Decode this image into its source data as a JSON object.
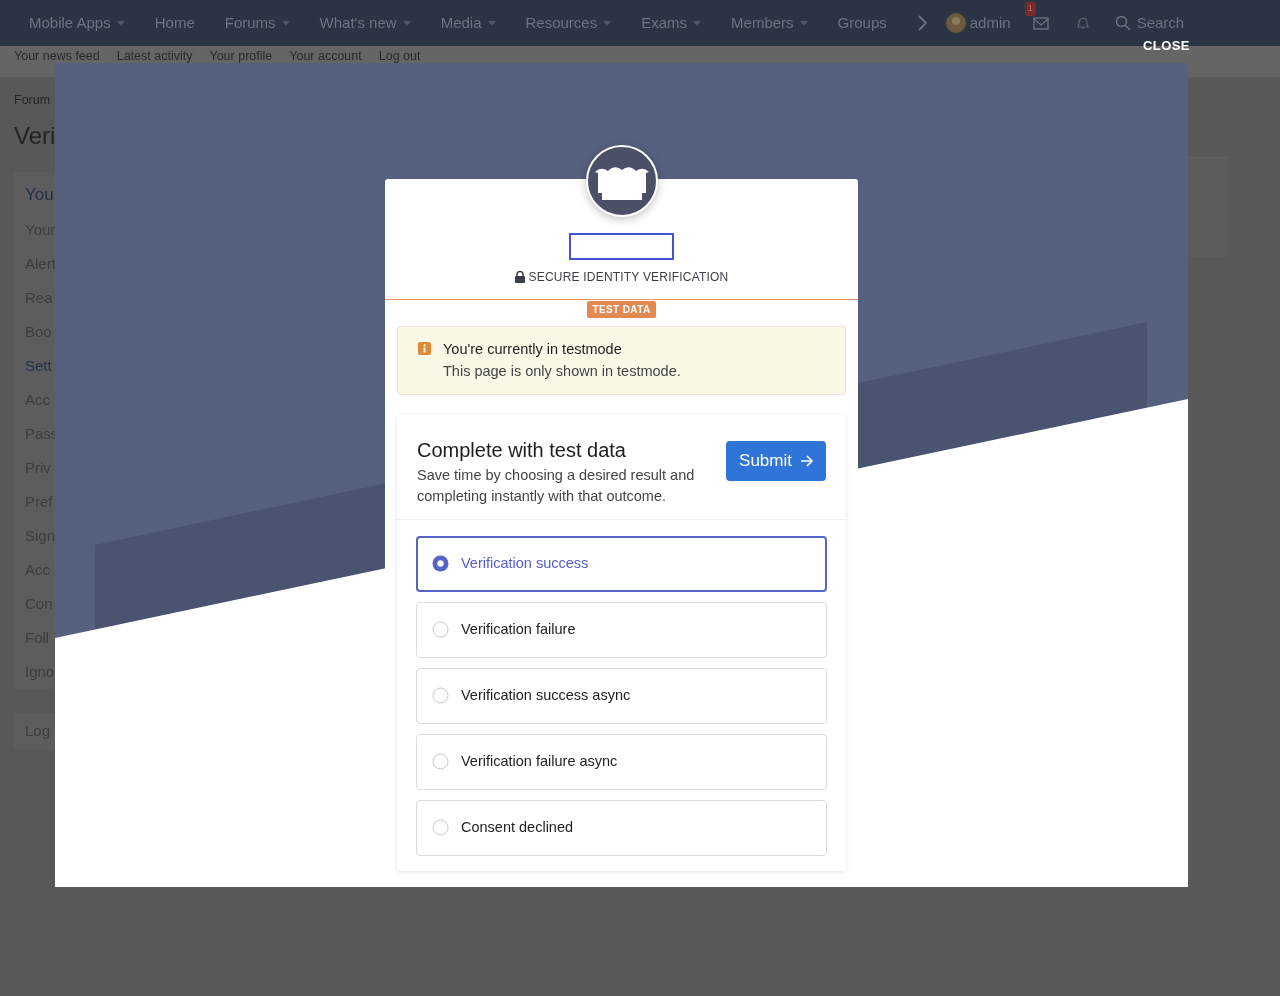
{
  "nav": {
    "items": [
      {
        "label": "Mobile Apps",
        "dropdown": true
      },
      {
        "label": "Home",
        "dropdown": false
      },
      {
        "label": "Forums",
        "dropdown": true
      },
      {
        "label": "What's new",
        "dropdown": true
      },
      {
        "label": "Media",
        "dropdown": true
      },
      {
        "label": "Resources",
        "dropdown": true
      },
      {
        "label": "Exams",
        "dropdown": true
      },
      {
        "label": "Members",
        "dropdown": true
      },
      {
        "label": "Groups",
        "dropdown": false
      }
    ],
    "user": "admin",
    "inbox_count": "1",
    "search": "Search"
  },
  "subnav": [
    "Your news feed",
    "Latest activity",
    "Your profile",
    "Your account",
    "Log out"
  ],
  "breadcrumb": "Forum",
  "page_title": "Veri",
  "sidebar": {
    "heading": "You",
    "items": [
      {
        "label": "Your",
        "kind": "link"
      },
      {
        "label": "Alert",
        "kind": "link"
      },
      {
        "label": "Rea",
        "kind": "link"
      },
      {
        "label": "Boo",
        "kind": "link"
      },
      {
        "label": "Sett",
        "kind": "heading"
      },
      {
        "label": "Acc",
        "kind": "link"
      },
      {
        "label": "Pass",
        "kind": "link"
      },
      {
        "label": "Priv",
        "kind": "link"
      },
      {
        "label": "Pref",
        "kind": "link"
      },
      {
        "label": "Sign",
        "kind": "link"
      },
      {
        "label": "Acc",
        "kind": "link"
      },
      {
        "label": "Con",
        "kind": "link"
      },
      {
        "label": "Foll",
        "kind": "link"
      },
      {
        "label": "Igno",
        "kind": "link"
      }
    ],
    "logout": "Log"
  },
  "close": "CLOSE",
  "verification": {
    "header": "SECURE IDENTITY VERIFICATION",
    "badge": "TEST DATA",
    "alert": {
      "title": "You're currently in testmode",
      "text": "This page is only shown in testmode."
    },
    "panel": {
      "title": "Complete with test data",
      "description": "Save time by choosing a desired result and completing instantly with that outcome.",
      "submit": "Submit"
    },
    "options": [
      {
        "label": "Verification success",
        "selected": true
      },
      {
        "label": "Verification failure",
        "selected": false
      },
      {
        "label": "Verification success async",
        "selected": false
      },
      {
        "label": "Verification failure async",
        "selected": false
      },
      {
        "label": "Consent declined",
        "selected": false
      }
    ]
  }
}
